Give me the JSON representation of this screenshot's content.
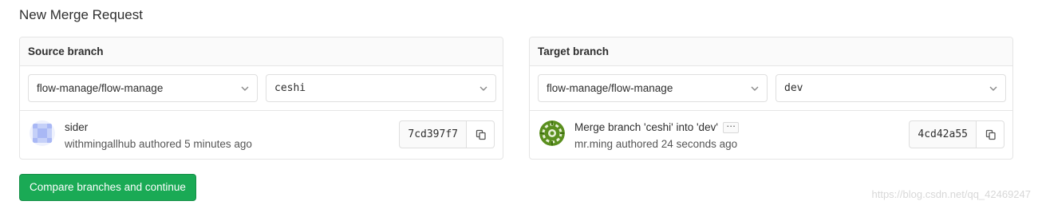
{
  "page": {
    "title": "New Merge Request"
  },
  "source": {
    "header": "Source branch",
    "project": "flow-manage/flow-manage",
    "branch": "ceshi",
    "commit": {
      "title": "sider",
      "meta": "withmingallhub authored 5 minutes ago",
      "sha": "7cd397f7"
    }
  },
  "target": {
    "header": "Target branch",
    "project": "flow-manage/flow-manage",
    "branch": "dev",
    "commit": {
      "title": "Merge branch 'ceshi' into 'dev'",
      "meta": "mr.ming authored 24 seconds ago",
      "sha": "4cd42a55"
    }
  },
  "actions": {
    "compare_label": "Compare branches and continue"
  },
  "watermark": "https://blog.csdn.net/qq_42469247",
  "colors": {
    "primary": "#1aaa55",
    "identicon_blue": "#a9b8f5",
    "avatar_green": "#5a8f1e"
  },
  "icons": [
    "chevron-down-icon",
    "copy-icon",
    "ellipsis-icon",
    "identicon-avatar",
    "user-avatar"
  ]
}
